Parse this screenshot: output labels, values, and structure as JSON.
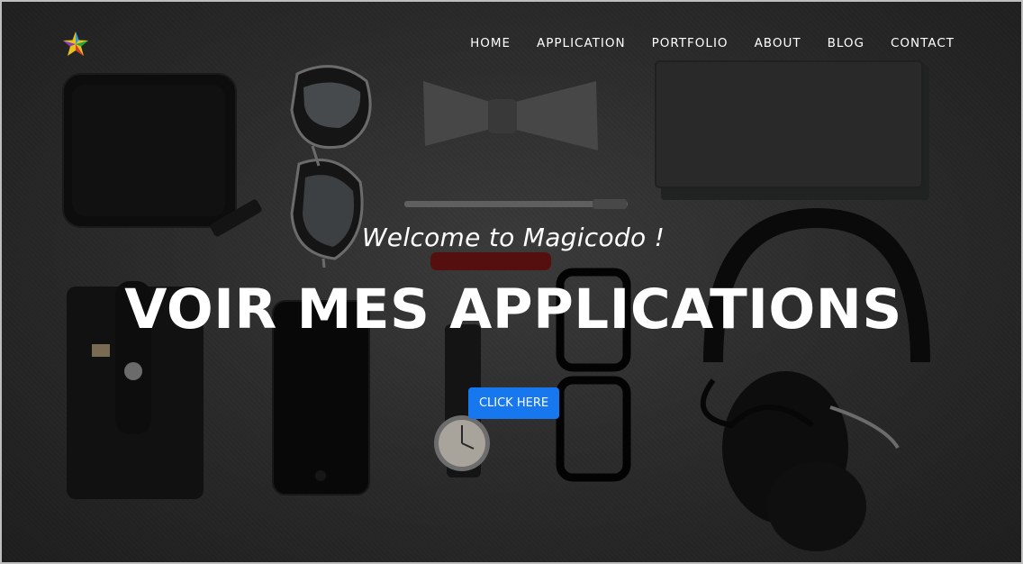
{
  "nav": {
    "items": [
      {
        "label": "HOME"
      },
      {
        "label": "APPLICATION"
      },
      {
        "label": "PORTFOLIO"
      },
      {
        "label": "ABOUT"
      },
      {
        "label": "BLOG"
      },
      {
        "label": "CONTACT"
      }
    ]
  },
  "hero": {
    "subtitle": "Welcome to Magicodo !",
    "title": "VOIR MES APPLICATIONS",
    "button_label": "CLICK HERE"
  },
  "colors": {
    "accent": "#1677ee",
    "text": "#ffffff"
  }
}
